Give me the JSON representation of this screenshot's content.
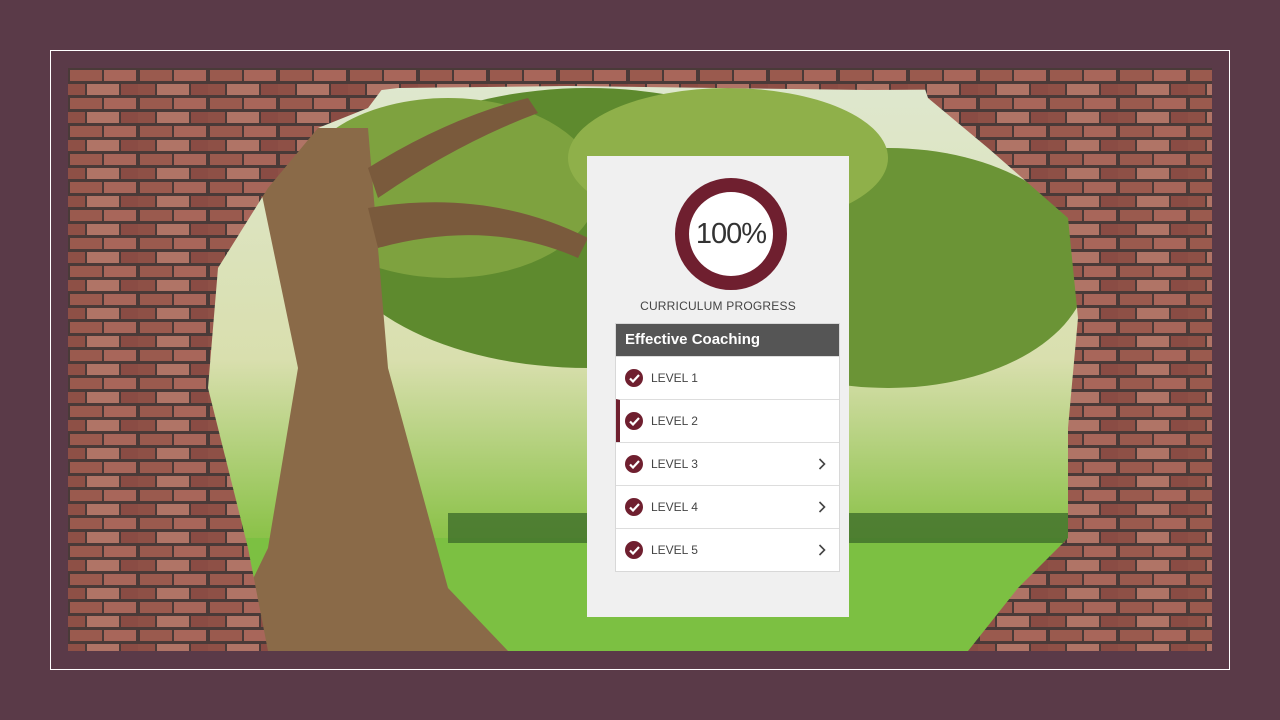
{
  "progress": {
    "value": "100%",
    "percent": 100,
    "label": "CURRICULUM PROGRESS"
  },
  "course": {
    "title": "Effective Coaching",
    "levels": [
      {
        "label": "LEVEL 1",
        "completed": true,
        "expandable": false,
        "active": false
      },
      {
        "label": "LEVEL 2",
        "completed": true,
        "expandable": false,
        "active": true
      },
      {
        "label": "LEVEL 3",
        "completed": true,
        "expandable": true,
        "active": false
      },
      {
        "label": "LEVEL 4",
        "completed": true,
        "expandable": true,
        "active": false
      },
      {
        "label": "LEVEL 5",
        "completed": true,
        "expandable": true,
        "active": false
      }
    ]
  },
  "icons": {
    "completed": "check-circle-icon",
    "expand": "chevron-right-icon"
  },
  "colors": {
    "accent": "#6f1f2f",
    "header": "#555555",
    "background": "#5a3a48",
    "panel": "#f0f0f0"
  }
}
